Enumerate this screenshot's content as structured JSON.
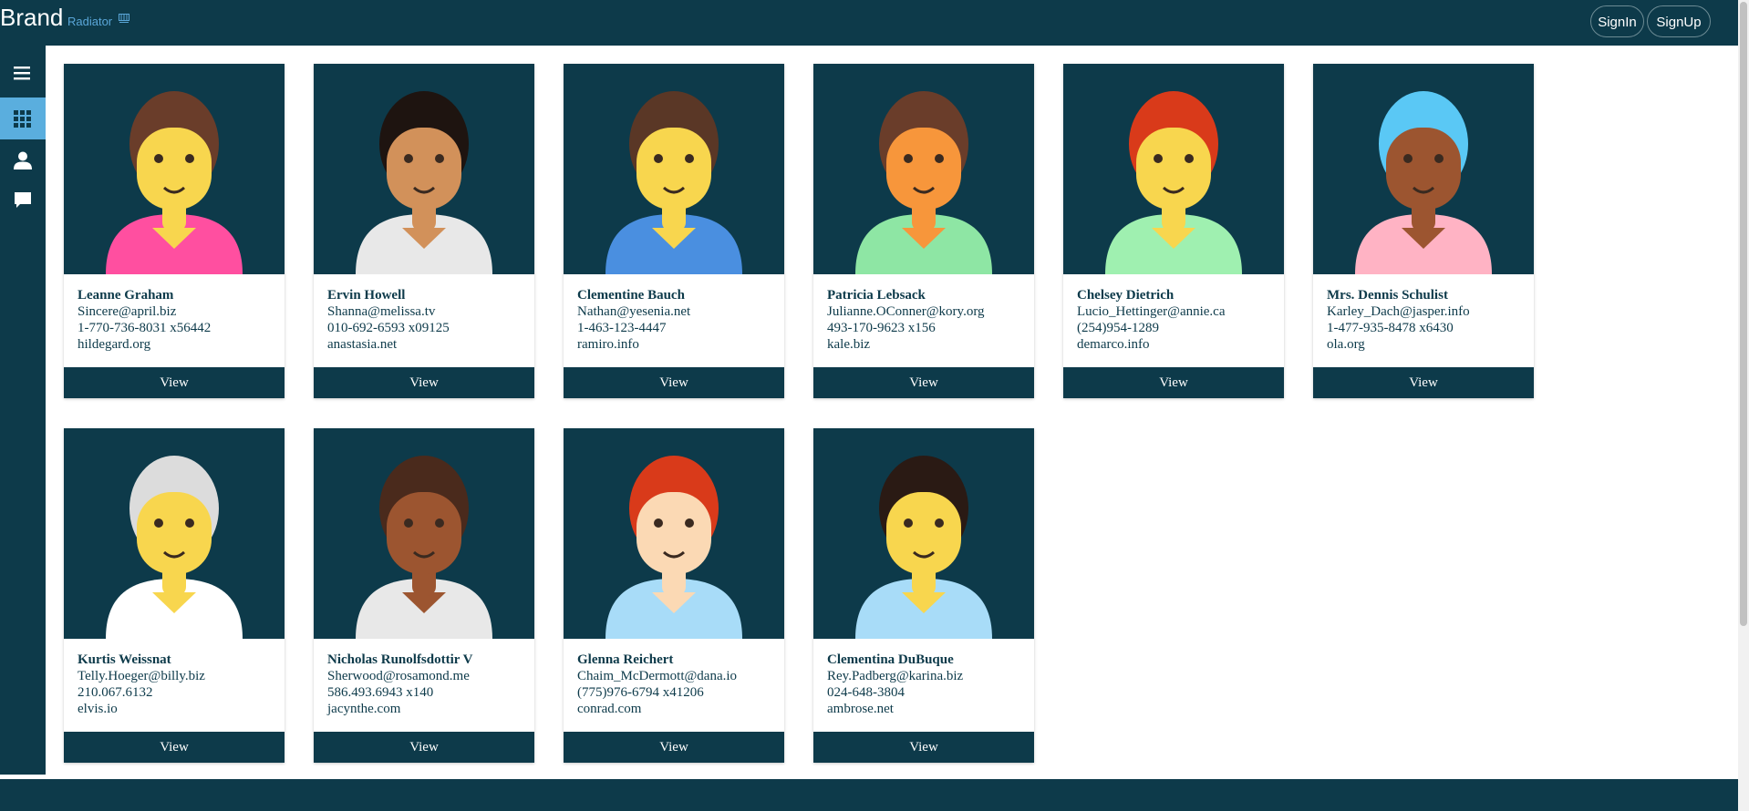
{
  "header": {
    "brand": "Brand",
    "brand_sub": "Radiator",
    "signin_label": "SignIn",
    "signup_label": "SignUp"
  },
  "sidebar": {
    "items": [
      {
        "icon": "menu-icon"
      },
      {
        "icon": "grid-icon",
        "active": true
      },
      {
        "icon": "user-icon"
      },
      {
        "icon": "chat-icon"
      }
    ]
  },
  "users": [
    {
      "name": "Leanne Graham",
      "email": "Sincere@april.biz",
      "phone": "1-770-736-8031 x56442",
      "website": "hildegard.org",
      "button": "View",
      "skin": "#f8d64e",
      "shirt": "#ff4fa0",
      "hair": "#6a3d2a"
    },
    {
      "name": "Ervin Howell",
      "email": "Shanna@melissa.tv",
      "phone": "010-692-6593 x09125",
      "website": "anastasia.net",
      "button": "View",
      "skin": "#d2915a",
      "shirt": "#e8e8e8",
      "hair": "#1e1410"
    },
    {
      "name": "Clementine Bauch",
      "email": "Nathan@yesenia.net",
      "phone": "1-463-123-4447",
      "website": "ramiro.info",
      "button": "View",
      "skin": "#f8d64e",
      "shirt": "#4a8fe0",
      "hair": "#5a3726"
    },
    {
      "name": "Patricia Lebsack",
      "email": "Julianne.OConner@kory.org",
      "phone": "493-170-9623 x156",
      "website": "kale.biz",
      "button": "View",
      "skin": "#f7963b",
      "shirt": "#8ee6a4",
      "hair": "#6a3d2a"
    },
    {
      "name": "Chelsey Dietrich",
      "email": "Lucio_Hettinger@annie.ca",
      "phone": "(254)954-1289",
      "website": "demarco.info",
      "button": "View",
      "skin": "#f8d64e",
      "shirt": "#9ff0b0",
      "hair": "#d93a1a"
    },
    {
      "name": "Mrs. Dennis Schulist",
      "email": "Karley_Dach@jasper.info",
      "phone": "1-477-935-8478 x6430",
      "website": "ola.org",
      "button": "View",
      "skin": "#9c5530",
      "shirt": "#ffb3c4",
      "hair": "#5ac8f5"
    },
    {
      "name": "Kurtis Weissnat",
      "email": "Telly.Hoeger@billy.biz",
      "phone": "210.067.6132",
      "website": "elvis.io",
      "button": "View",
      "skin": "#f8d64e",
      "shirt": "#ffffff",
      "hair": "#dcdcdc"
    },
    {
      "name": "Nicholas Runolfsdottir V",
      "email": "Sherwood@rosamond.me",
      "phone": "586.493.6943 x140",
      "website": "jacynthe.com",
      "button": "View",
      "skin": "#9c5530",
      "shirt": "#e8e8e8",
      "hair": "#4a2a1c"
    },
    {
      "name": "Glenna Reichert",
      "email": "Chaim_McDermott@dana.io",
      "phone": "(775)976-6794 x41206",
      "website": "conrad.com",
      "button": "View",
      "skin": "#fbd9b4",
      "shirt": "#a8dcf8",
      "hair": "#d93a1a"
    },
    {
      "name": "Clementina DuBuque",
      "email": "Rey.Padberg@karina.biz",
      "phone": "024-648-3804",
      "website": "ambrose.net",
      "button": "View",
      "skin": "#f8d64e",
      "shirt": "#a8dcf8",
      "hair": "#2a1a14"
    }
  ]
}
